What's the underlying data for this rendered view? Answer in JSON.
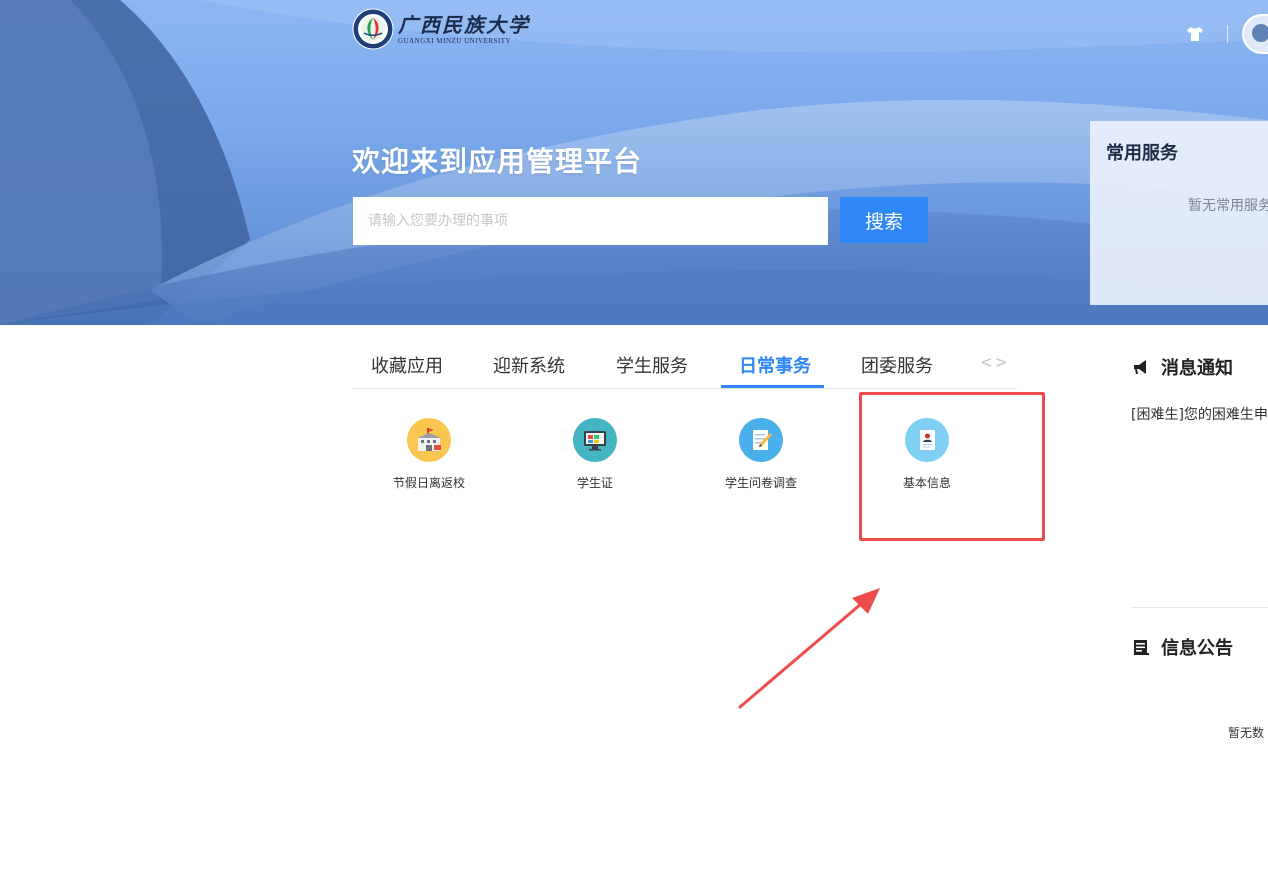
{
  "header": {
    "logo_cn": "广西民族大学",
    "logo_en": "GUANGXI MINZU UNIVERSITY",
    "icons": [
      "shirt-icon",
      "avatar"
    ]
  },
  "hero": {
    "welcome": "欢迎来到应用管理平台",
    "search_placeholder": "请输入您要办理的事项",
    "search_button": "搜索"
  },
  "common_services": {
    "title": "常用服务",
    "empty": "暂无常用服务"
  },
  "tabs": {
    "items": [
      {
        "label": "收藏应用",
        "active": false
      },
      {
        "label": "迎新系统",
        "active": false
      },
      {
        "label": "学生服务",
        "active": false
      },
      {
        "label": "日常事务",
        "active": true
      },
      {
        "label": "团委服务",
        "active": false
      }
    ],
    "prev": "<",
    "next": ">"
  },
  "apps": [
    {
      "label": "节假日离返校",
      "icon": "school-building-icon",
      "color": "#f9c74f"
    },
    {
      "label": "学生证",
      "icon": "monitor-card-icon",
      "color": "#45b5c4"
    },
    {
      "label": "学生问卷调查",
      "icon": "pencil-document-icon",
      "color": "#4ab0ec"
    },
    {
      "label": "基本信息",
      "icon": "profile-document-icon",
      "color": "#7fd0f5"
    }
  ],
  "news": {
    "title": "消息通知",
    "item": "[困难生]您的困难生申"
  },
  "notices": {
    "title": "信息公告",
    "empty": "暂无数"
  },
  "colors": {
    "accent": "#2f86f6",
    "highlight": "#ee4c4c"
  }
}
